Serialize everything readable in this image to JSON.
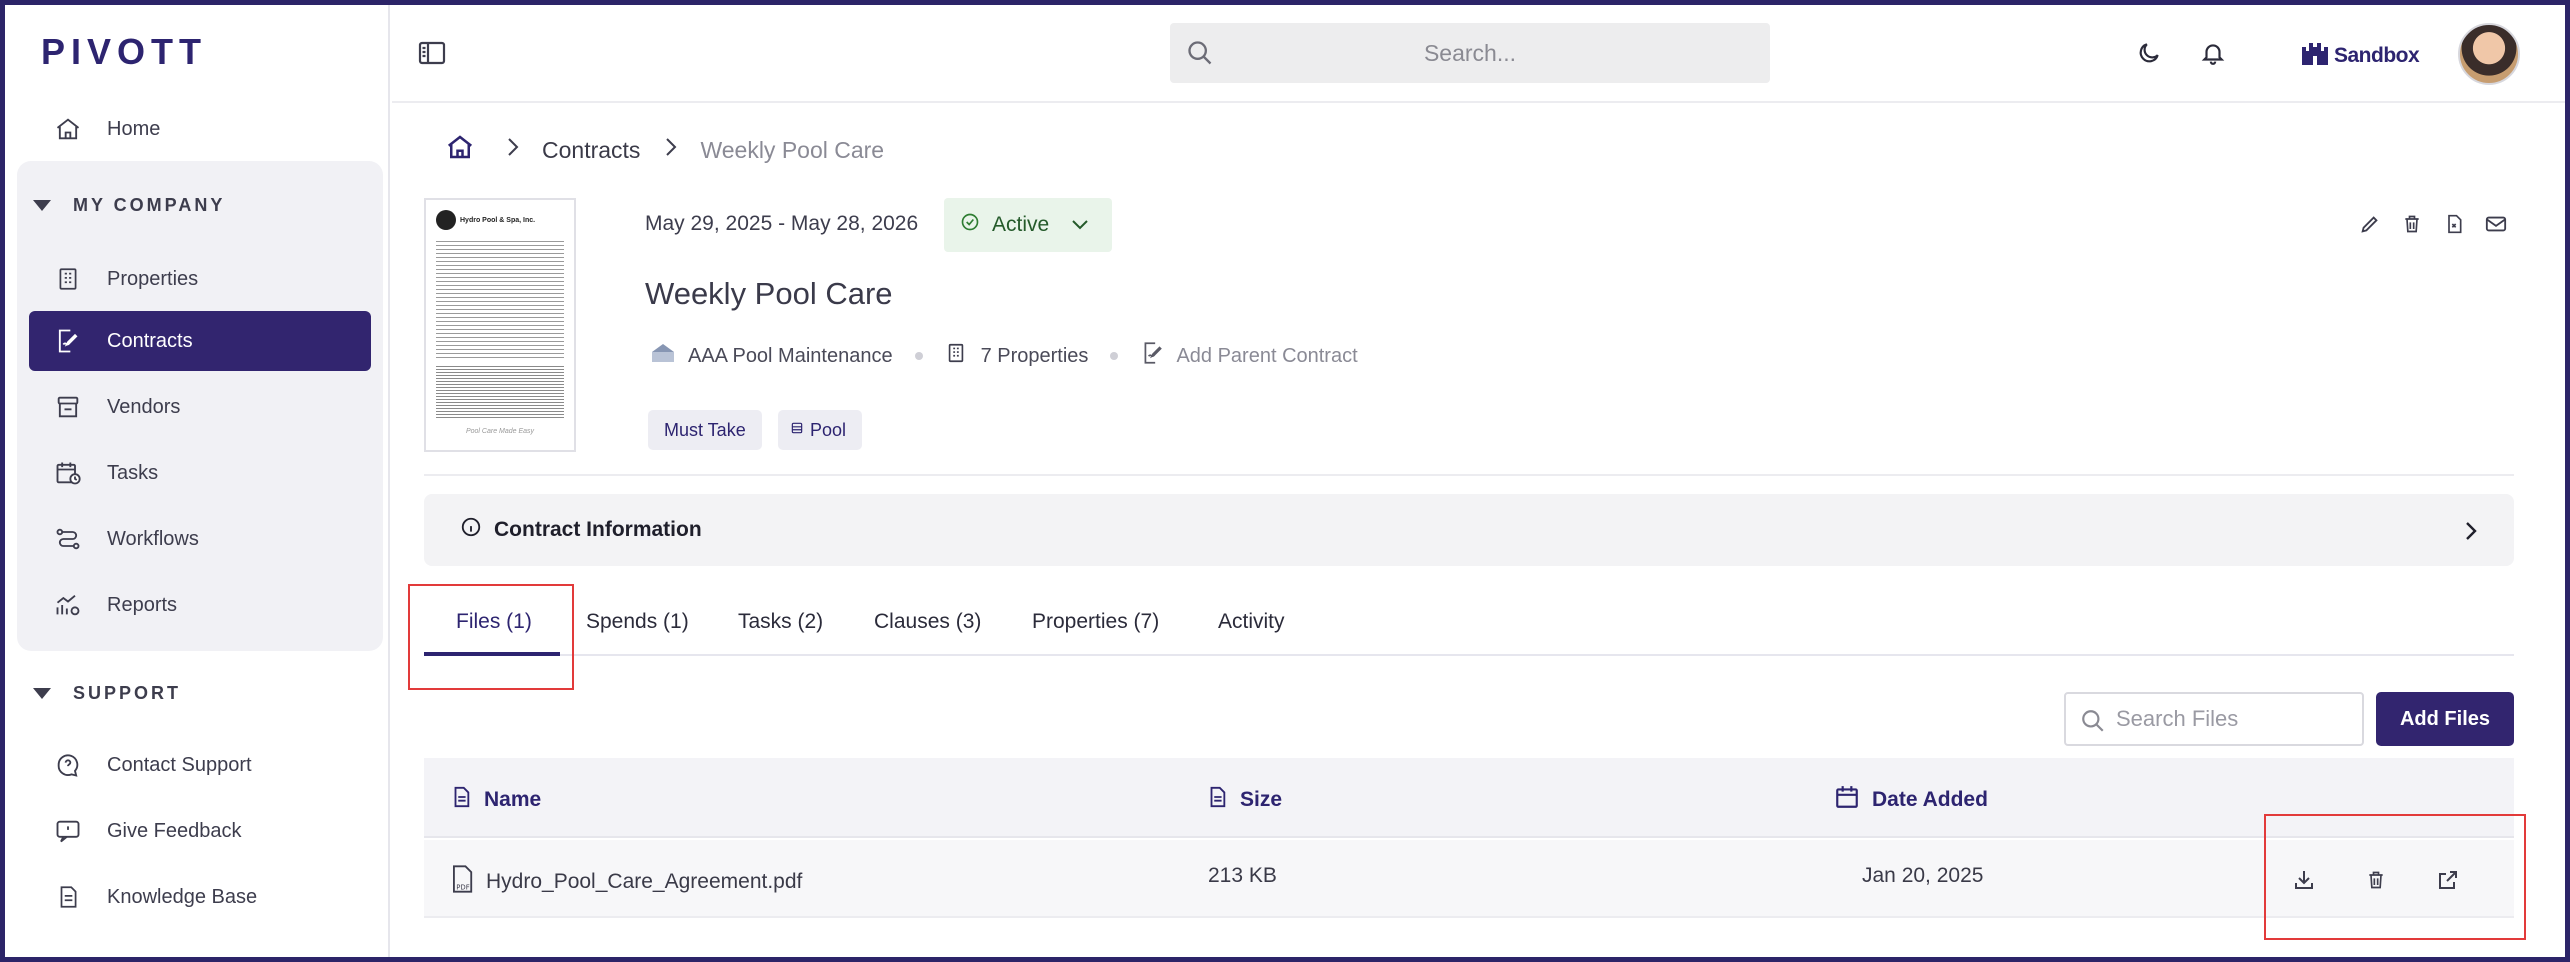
{
  "brand": {
    "logo": "PIVOTT",
    "sandbox_label": "Sandbox"
  },
  "sidebar": {
    "home": "Home",
    "sections": [
      {
        "title": "MY COMPANY",
        "items": [
          "Properties",
          "Contracts",
          "Vendors",
          "Tasks",
          "Workflows",
          "Reports"
        ],
        "active": "Contracts"
      },
      {
        "title": "SUPPORT",
        "items": [
          "Contact Support",
          "Give Feedback",
          "Knowledge Base"
        ]
      }
    ]
  },
  "topbar": {
    "search_placeholder": "Search..."
  },
  "breadcrumb": {
    "home_icon": "home-icon",
    "contracts": "Contracts",
    "current": "Weekly Pool Care"
  },
  "contract": {
    "date_range": "May 29, 2025 - May 28, 2026",
    "status": "Active",
    "title": "Weekly Pool Care",
    "vendor": "AAA Pool Maintenance",
    "properties": "7 Properties",
    "add_parent": "Add Parent Contract",
    "tags": [
      "Must Take",
      "Pool"
    ],
    "thumb_caption": "Hydro Pool & Spa, Inc.",
    "thumb_footer": "Pool Care Made Easy"
  },
  "info_bar": {
    "label": "Contract Information"
  },
  "tabs": [
    "Files (1)",
    "Spends (1)",
    "Tasks (2)",
    "Clauses (3)",
    "Properties (7)",
    "Activity"
  ],
  "files": {
    "search_placeholder": "Search Files",
    "add_button": "Add Files",
    "columns": [
      "Name",
      "Size",
      "Date Added"
    ],
    "rows": [
      {
        "name": "Hydro_Pool_Care_Agreement.pdf",
        "size": "213 KB",
        "date": "Jan 20, 2025"
      }
    ]
  },
  "colors": {
    "brand": "#32256f",
    "active_green": "#245a2a",
    "highlight": "#e23a3a"
  }
}
